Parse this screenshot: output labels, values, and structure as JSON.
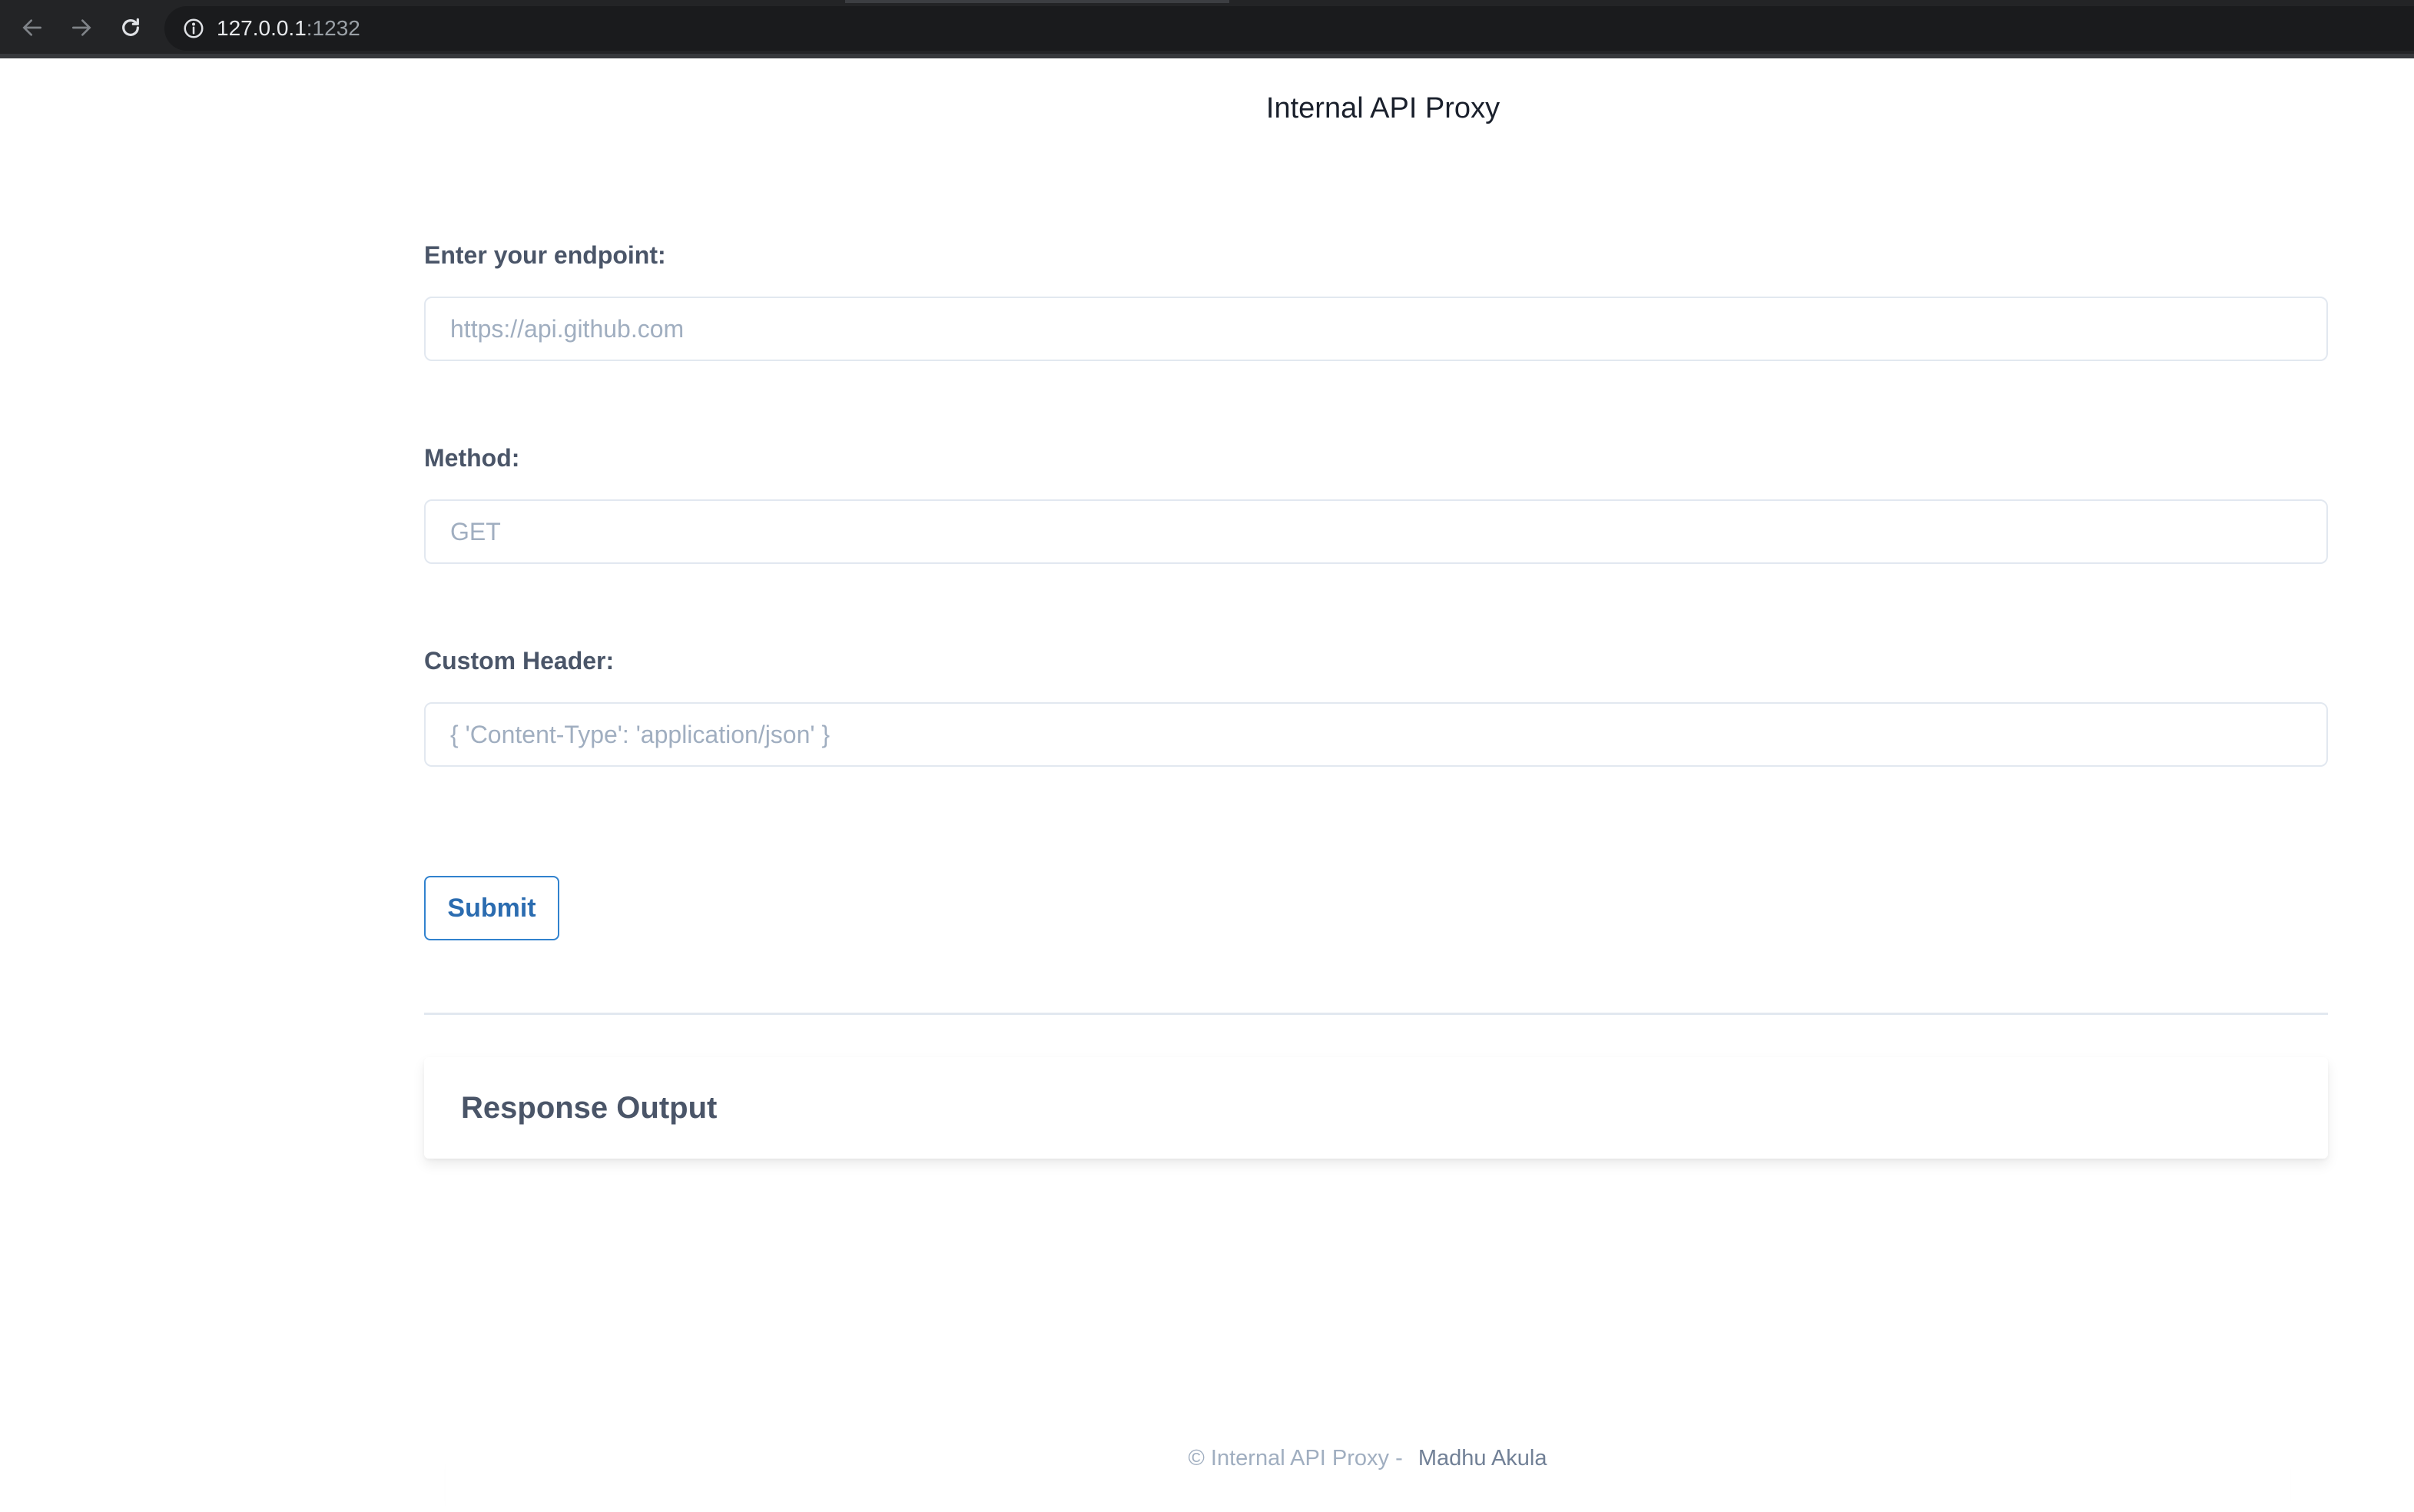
{
  "browser": {
    "url_host": "127.0.0.1",
    "url_port": ":1232"
  },
  "page": {
    "title": "Internal API Proxy"
  },
  "form": {
    "endpoint_label": "Enter your endpoint:",
    "endpoint_placeholder": "https://api.github.com",
    "method_label": "Method:",
    "method_placeholder": "GET",
    "header_label": "Custom Header:",
    "header_placeholder": "{ 'Content-Type': 'application/json' }",
    "submit_label": "Submit"
  },
  "response": {
    "title": "Response Output"
  },
  "footer": {
    "copyright": "© Internal API Proxy - ",
    "author": "Madhu Akula"
  },
  "colors": {
    "accent": "#3182ce",
    "label": "#4a5568",
    "placeholder": "#a0aec0"
  }
}
